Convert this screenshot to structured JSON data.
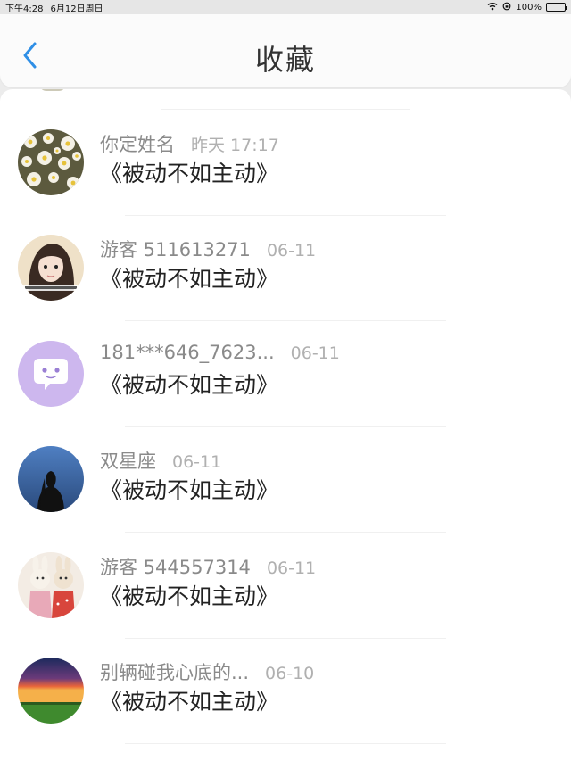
{
  "status_bar": {
    "time": "下午4:28",
    "date": "6月12日周日",
    "battery": "100%"
  },
  "header": {
    "title": "收藏"
  },
  "items": [
    {
      "name": "你定姓名",
      "time": "昨天 17:17",
      "title": "《被动不如主动》",
      "avatar": "daisy-flowers-avatar"
    },
    {
      "name": "游客 511613271",
      "time": "06-11",
      "title": "《被动不如主动》",
      "avatar": "girl-portrait-avatar"
    },
    {
      "name": "181***646_7623...",
      "time": "06-11",
      "title": "《被动不如主动》",
      "avatar": "chat-bubble-avatar"
    },
    {
      "name": "双星座",
      "time": "06-11",
      "title": "《被动不如主动》",
      "avatar": "night-silhouette-avatar"
    },
    {
      "name": "游客 544557314",
      "time": "06-11",
      "title": "《被动不如主动》",
      "avatar": "bunny-toys-avatar"
    },
    {
      "name": "别辆碰我心底的...",
      "time": "06-10",
      "title": "《被动不如主动》",
      "avatar": "sunset-field-avatar"
    }
  ],
  "colors": {
    "accent": "#2f8fe6",
    "name_text": "#8a8a8a",
    "time_text": "#b0b0b0",
    "title_text": "#222222"
  }
}
